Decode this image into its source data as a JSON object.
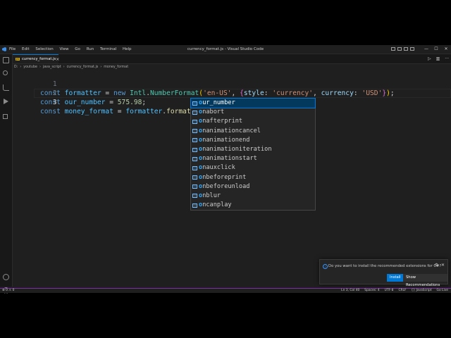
{
  "titlebar": {
    "menu": [
      "File",
      "Edit",
      "Selection",
      "View",
      "Go",
      "Run",
      "Terminal",
      "Help"
    ],
    "title": "currency_format.js - Visual Studio Code",
    "controls": {
      "minimize": "—",
      "maximize": "☐",
      "close": "✕"
    }
  },
  "tab": {
    "badge": "JS",
    "name": "currency_format.js",
    "close": "×"
  },
  "editor_actions": {
    "run": "▷",
    "split": "▥",
    "more": "···"
  },
  "breadcrumb": [
    "D:",
    "youtube",
    "java_script",
    "currency_format.js",
    "money_format"
  ],
  "code": {
    "line_numbers": [
      "1",
      "2",
      "3"
    ],
    "line1": {
      "kw": "const",
      "var": "formatter",
      "eq": " = ",
      "kw2": "new",
      "cls1": "Intl",
      "dot": ".",
      "cls2": "NumberFormat",
      "open": "(",
      "str1": "'en-US'",
      "comma": ", ",
      "brace_open": "{",
      "prop1": "style",
      "colon1": ": ",
      "str2": "'currency'",
      "comma2": ", ",
      "prop2": "currency",
      "colon2": ": ",
      "str3": "'USD'",
      "brace_close": "}",
      "close": ")",
      "semi": ";"
    },
    "line2": {
      "kw": "const",
      "var": "our_number",
      "eq": " = ",
      "num": "575.98",
      "semi": ";"
    },
    "line3": {
      "kw": "const",
      "var": "money_format",
      "eq": " = ",
      "obj": "formatter",
      "dot": ".",
      "fn": "format",
      "open": "(",
      "typed": "o",
      "close": ")"
    }
  },
  "suggestions": [
    {
      "match": "o",
      "rest": "ur_number",
      "selected": true
    },
    {
      "match": "o",
      "rest": "nabort"
    },
    {
      "match": "o",
      "rest": "nafterprint"
    },
    {
      "match": "o",
      "rest": "nanimationcancel"
    },
    {
      "match": "o",
      "rest": "nanimationend"
    },
    {
      "match": "o",
      "rest": "nanimationiteration"
    },
    {
      "match": "o",
      "rest": "nanimationstart"
    },
    {
      "match": "o",
      "rest": "nauxclick"
    },
    {
      "match": "o",
      "rest": "nbeforeprint"
    },
    {
      "match": "o",
      "rest": "nbeforeunload"
    },
    {
      "match": "o",
      "rest": "nblur"
    },
    {
      "match": "o",
      "rest": "ncanplay"
    }
  ],
  "notification": {
    "message": "Do you want to install the recommended extensions for C#?",
    "install": "Install",
    "show": "Show Recommendations",
    "gear": "⚙",
    "close": "✕"
  },
  "statusbar": {
    "left": "⊗ 0 ⚠ 0",
    "position": "Ln 3, Col 40",
    "spaces": "Spaces: 4",
    "encoding": "UTF-8",
    "eol": "CRLF",
    "language": "{} JavaScript",
    "golive": "Go Live"
  },
  "colors": {
    "accent": "#0078d4",
    "status_border": "#7b2fa0",
    "background": "#1f1f1f"
  },
  "icons": [
    "vscode-logo-icon",
    "files-icon",
    "search-icon",
    "source-control-icon",
    "run-debug-icon",
    "extensions-icon",
    "account-icon",
    "settings-gear-icon",
    "property-icon",
    "info-icon"
  ]
}
